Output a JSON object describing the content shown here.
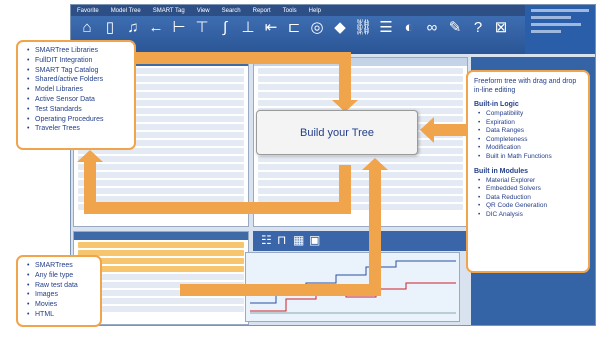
{
  "menubar": {
    "tabs": [
      "Favorite",
      "Model Tree",
      "SMART Tag",
      "View",
      "Search",
      "Report",
      "Tools",
      "Help"
    ]
  },
  "toolbar": {
    "icons": [
      {
        "name": "home-icon",
        "glyph": "⌂"
      },
      {
        "name": "document-icon",
        "glyph": "▯"
      },
      {
        "name": "music-note-icon",
        "glyph": "♫"
      },
      {
        "name": "arrow-left-icon",
        "glyph": "←"
      },
      {
        "name": "branch-icon",
        "glyph": "⊢"
      },
      {
        "name": "pin-icon",
        "glyph": "⊤"
      },
      {
        "name": "curve-icon",
        "glyph": "∫"
      },
      {
        "name": "split-icon",
        "glyph": "⊥"
      },
      {
        "name": "move-icon",
        "glyph": "⇤"
      },
      {
        "name": "link-icon",
        "glyph": "⊏"
      },
      {
        "name": "target-icon",
        "glyph": "◎"
      },
      {
        "name": "diamond-icon",
        "glyph": "◆"
      },
      {
        "name": "chain-icon",
        "glyph": "⛓"
      },
      {
        "name": "list-icon",
        "glyph": "☰"
      },
      {
        "name": "circle-arrow-icon",
        "glyph": "◐"
      },
      {
        "name": "binoculars-icon",
        "glyph": "∞"
      },
      {
        "name": "wrench-icon",
        "glyph": "✎"
      },
      {
        "name": "help-icon",
        "glyph": "?"
      },
      {
        "name": "close-icon",
        "glyph": "⊠"
      }
    ]
  },
  "center": {
    "label": "Build your Tree"
  },
  "left_top_callout": {
    "items": [
      "SMARTree Libraries",
      "FullDIT Integration",
      "SMART Tag Catalog",
      "Shared/active Folders",
      "Model Libraries",
      "Active Sensor Data",
      "Test Standards",
      "Operating Procedures",
      "Traveler Trees"
    ]
  },
  "left_bottom_callout": {
    "items": [
      "SMARTrees",
      "Any file type",
      "Raw test data",
      "Images",
      "Movies",
      "HTML"
    ]
  },
  "right_callout": {
    "intro": "Freeform tree with drag and drop in-line editing",
    "logic_heading": "Built-in Logic",
    "logic_items": [
      "Compatibility",
      "Expiration",
      "Data Ranges",
      "Completeness",
      "Modification",
      "Built in Math Functions"
    ],
    "modules_heading": "Built in Modules",
    "modules_items": [
      "Material Explorer",
      "Embedded Solvers",
      "Data Reduction",
      "QR Code Generation",
      "DIC Analysis"
    ]
  },
  "colors": {
    "accent_orange": "#f0a44b",
    "text_blue": "#243f8a",
    "ribbon_blue": "#2d4f86"
  }
}
